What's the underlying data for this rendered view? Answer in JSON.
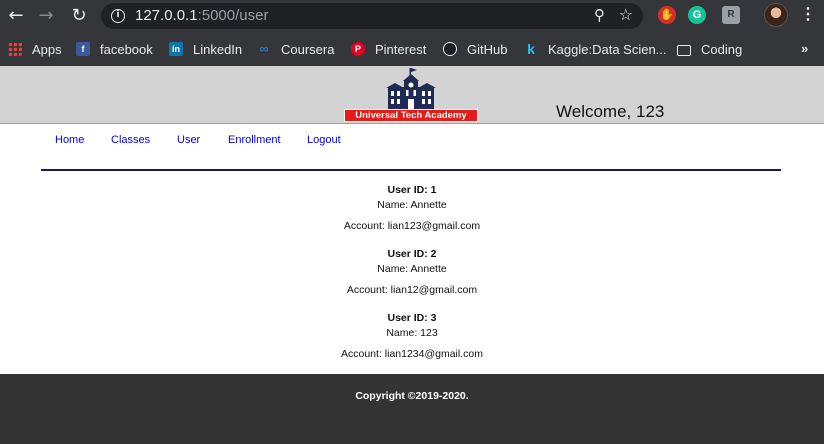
{
  "browser": {
    "url_host": "127.0.0.1",
    "url_rest": ":5000/user",
    "back_icon": "arrow-left-icon",
    "forward_icon": "arrow-right-icon",
    "reload_icon": "reload-icon"
  },
  "bookmarks": [
    {
      "label": "Apps",
      "icon": "apps-grid-icon"
    },
    {
      "label": "facebook",
      "icon": "facebook-icon"
    },
    {
      "label": "LinkedIn",
      "icon": "linkedin-icon"
    },
    {
      "label": "Coursera",
      "icon": "coursera-icon"
    },
    {
      "label": "Pinterest",
      "icon": "pinterest-icon"
    },
    {
      "label": "GitHub",
      "icon": "github-icon"
    },
    {
      "label": "Kaggle:Data Scien...",
      "icon": "kaggle-icon"
    },
    {
      "label": "Coding",
      "icon": "folder-icon"
    }
  ],
  "header": {
    "logo_text": "Universal Tech Academy",
    "welcome": "Welcome, 123"
  },
  "nav": {
    "home": "Home",
    "classes": "Classes",
    "user": "User",
    "enrollment": "Enrollment",
    "logout": "Logout"
  },
  "users": [
    {
      "id_text": "User ID: 1",
      "name_text": "Name: Annette",
      "account_text": "Account: lian123@gmail.com"
    },
    {
      "id_text": "User ID: 2",
      "name_text": "Name: Annette",
      "account_text": "Account: lian12@gmail.com"
    },
    {
      "id_text": "User ID: 3",
      "name_text": "Name: 123",
      "account_text": "Account: lian1234@gmail.com"
    }
  ],
  "footer": {
    "copyright": "Copyright ©2019-2020."
  },
  "colors": {
    "chrome": "#35363a",
    "header_bg": "#d3d3d3",
    "logo_red": "#e41b17",
    "logo_navy": "#1f2a55",
    "link": "#0000ee",
    "footer_bg": "#333333"
  }
}
